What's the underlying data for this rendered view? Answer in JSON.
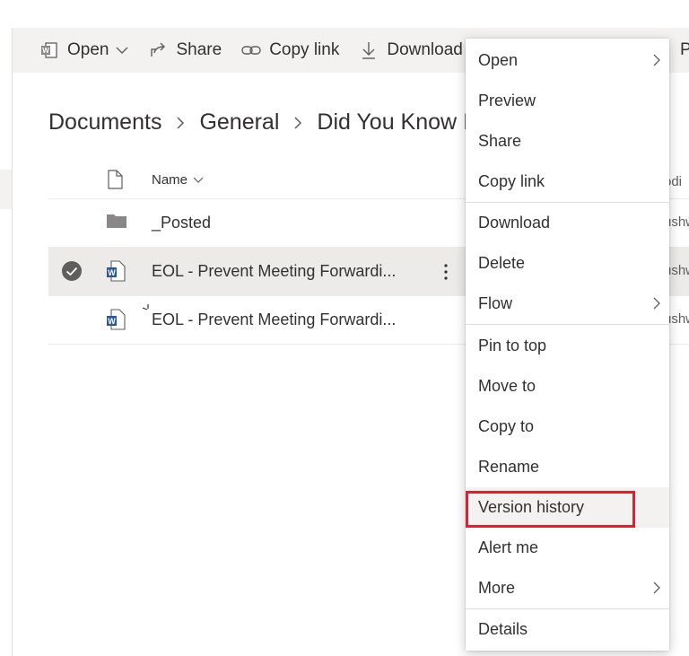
{
  "commandbar": {
    "open": "Open",
    "share": "Share",
    "copy_link": "Copy link",
    "download": "Download",
    "right_partial": "P"
  },
  "breadcrumb": {
    "items": [
      "Documents",
      "General",
      "Did You Know I"
    ]
  },
  "list": {
    "header": {
      "name": "Name",
      "modified_partial": "odi"
    },
    "rows": [
      {
        "name": "_Posted",
        "modified_by": "ushw",
        "type": "folder",
        "selected": false
      },
      {
        "name": "EOL - Prevent Meeting Forwardi...",
        "modified_by": "ushw",
        "type": "word",
        "selected": true
      },
      {
        "name": "EOL - Prevent Meeting Forwardi...",
        "modified_by": "ushw",
        "type": "word",
        "selected": false,
        "new": true
      }
    ]
  },
  "context_menu": {
    "items": [
      "Open",
      "Preview",
      "Share",
      "Copy link",
      "Download",
      "Delete",
      "Flow",
      "Pin to top",
      "Move to",
      "Copy to",
      "Rename",
      "Version history",
      "Alert me",
      "More",
      "Details"
    ]
  },
  "colors": {
    "commandbar_bg": "#f3f2f1",
    "selected_row": "#edebe9",
    "highlight_box": "#e0202f",
    "word_blue": "#2b579a"
  }
}
